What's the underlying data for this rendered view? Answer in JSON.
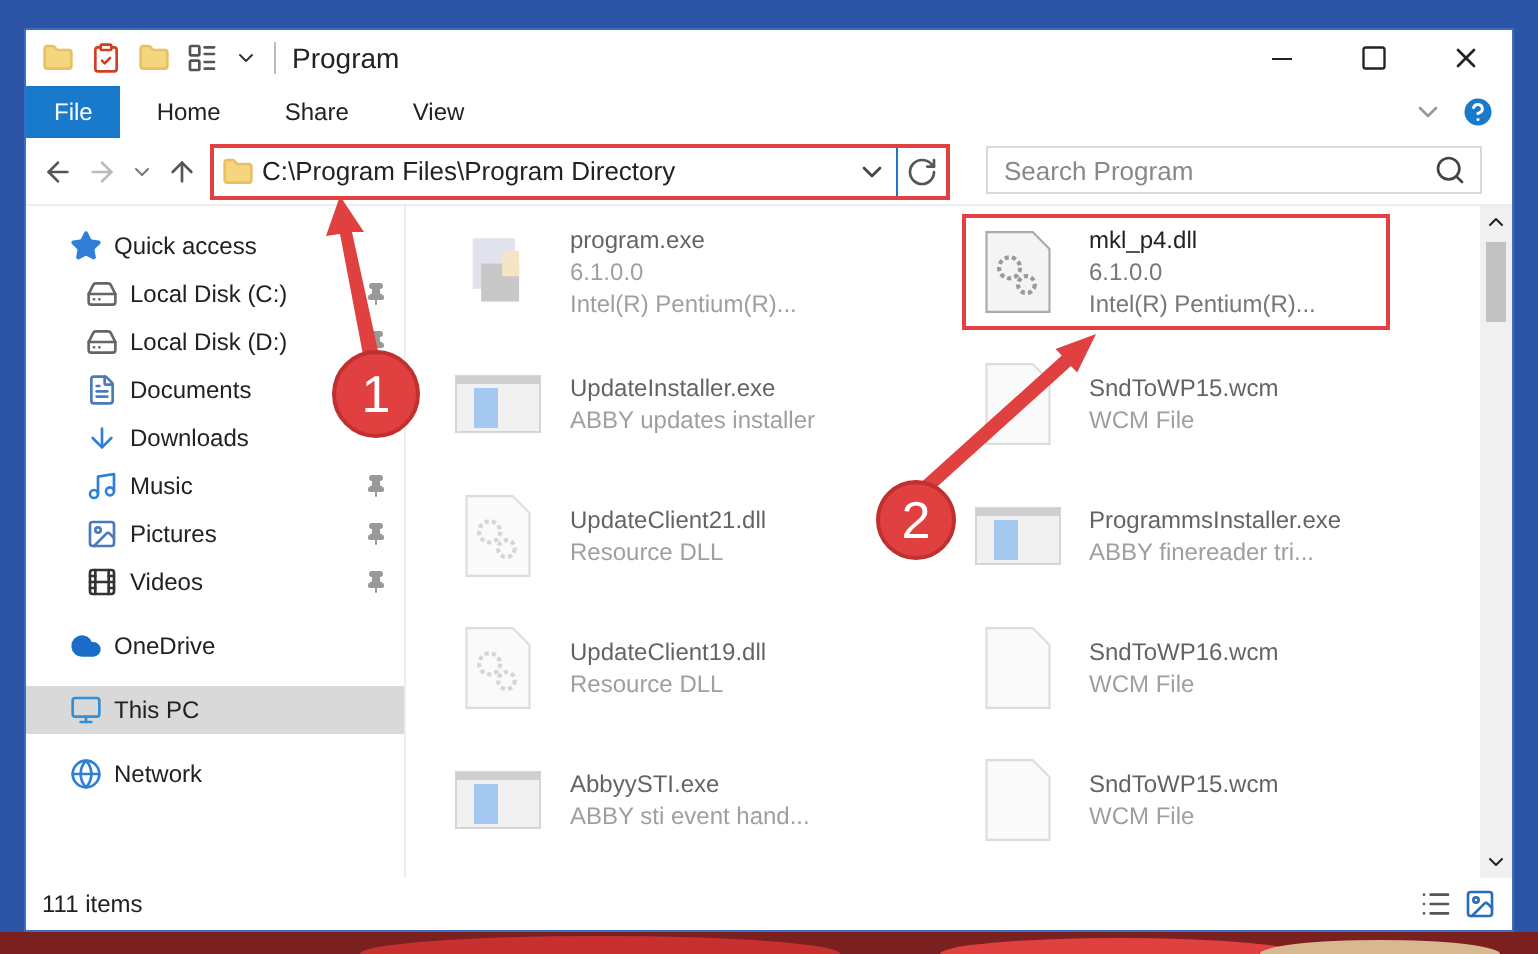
{
  "window": {
    "title": "Program"
  },
  "ribbon_tabs": [
    {
      "label": "File",
      "selected": true
    },
    {
      "label": "Home",
      "selected": false
    },
    {
      "label": "Share",
      "selected": false
    },
    {
      "label": "View",
      "selected": false
    }
  ],
  "address": {
    "path": "C:\\Program Files\\Program Directory",
    "highlighted": true
  },
  "search": {
    "placeholder": "Search Program"
  },
  "nav": [
    {
      "label": "Quick access",
      "kind": "star",
      "children": [
        {
          "label": "Local Disk (C:)",
          "kind": "disk",
          "pinned": true
        },
        {
          "label": "Local Disk (D:)",
          "kind": "disk",
          "pinned": true
        },
        {
          "label": "Documents",
          "kind": "docs"
        },
        {
          "label": "Downloads",
          "kind": "download"
        },
        {
          "label": "Music",
          "kind": "music",
          "pinned": true
        },
        {
          "label": "Pictures",
          "kind": "pictures",
          "pinned": true
        },
        {
          "label": "Videos",
          "kind": "videos",
          "pinned": true
        }
      ],
      "selected": false
    },
    {
      "label": "OneDrive",
      "kind": "cloud",
      "selected": false
    },
    {
      "label": "This PC",
      "kind": "pc",
      "selected": true
    },
    {
      "label": "Network",
      "kind": "network",
      "selected": false
    }
  ],
  "files": [
    {
      "name": "program.exe",
      "details": [
        "6.1.0.0",
        "Intel(R) Pentium(R)..."
      ],
      "kind": "exe",
      "blurred": true,
      "highlighted": false
    },
    {
      "name": "mkl_p4.dll",
      "details": [
        "6.1.0.0",
        "Intel(R) Pentium(R)..."
      ],
      "kind": "dll",
      "blurred": false,
      "highlighted": true
    },
    {
      "name": "UpdateInstaller.exe",
      "details": [
        "ABBY updates installer"
      ],
      "kind": "app",
      "blurred": true,
      "highlighted": false
    },
    {
      "name": "SndToWP15.wcm",
      "details": [
        "WCM File"
      ],
      "kind": "blank",
      "blurred": true,
      "highlighted": false
    },
    {
      "name": "UpdateClient21.dll",
      "details": [
        "Resource DLL"
      ],
      "kind": "dll",
      "blurred": true,
      "highlighted": false
    },
    {
      "name": "ProgrammsInstaller.exe",
      "details": [
        "ABBY finereader tri..."
      ],
      "kind": "app",
      "blurred": true,
      "highlighted": false
    },
    {
      "name": "UpdateClient19.dll",
      "details": [
        "Resource DLL"
      ],
      "kind": "dll",
      "blurred": true,
      "highlighted": false
    },
    {
      "name": "SndToWP16.wcm",
      "details": [
        "WCM File"
      ],
      "kind": "blank",
      "blurred": true,
      "highlighted": false
    },
    {
      "name": "AbbyySTI.exe",
      "details": [
        "ABBY sti event hand..."
      ],
      "kind": "app",
      "blurred": true,
      "highlighted": false
    },
    {
      "name": "SndToWP15.wcm",
      "details": [
        "WCM File"
      ],
      "kind": "blank",
      "blurred": true,
      "highlighted": false
    }
  ],
  "status_bar": {
    "count": "111 items"
  },
  "annotations": [
    {
      "label": "1"
    },
    {
      "label": "2"
    }
  ]
}
